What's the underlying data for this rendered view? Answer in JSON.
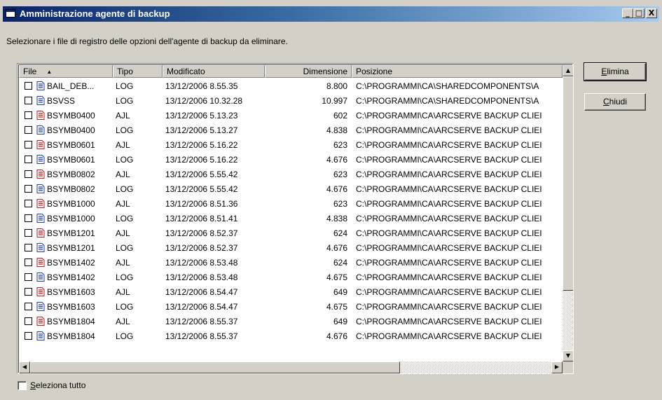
{
  "window": {
    "title": "Amministrazione agente di backup",
    "minimize_glyph": "_",
    "maximize_glyph": "□",
    "close_glyph": "X"
  },
  "instruction": "Selezionare i file di registro delle opzioni dell'agente di backup da eliminare.",
  "columns": {
    "file": "File",
    "tipo": "Tipo",
    "modificato": "Modificato",
    "dimensione": "Dimensione",
    "posizione": "Posizione",
    "sort_indicator": "▲"
  },
  "rows": [
    {
      "file": "BAIL_DEB...",
      "tipo": "LOG",
      "modificato": "13/12/2006 8.55.35",
      "dimensione": "8.800",
      "posizione": "C:\\PROGRAMMI\\CA\\SHAREDCOMPONENTS\\A",
      "icon": "log-file-icon"
    },
    {
      "file": "BSVSS",
      "tipo": "LOG",
      "modificato": "13/12/2006 10.32.28",
      "dimensione": "10.997",
      "posizione": "C:\\PROGRAMMI\\CA\\SHAREDCOMPONENTS\\A",
      "icon": "log-file-icon"
    },
    {
      "file": "BSYMB0400",
      "tipo": "AJL",
      "modificato": "13/12/2006 5.13.23",
      "dimensione": "602",
      "posizione": "C:\\PROGRAMMI\\CA\\ARCSERVE BACKUP CLIEI",
      "icon": "ajl-file-icon"
    },
    {
      "file": "BSYMB0400",
      "tipo": "LOG",
      "modificato": "13/12/2006 5.13.27",
      "dimensione": "4.838",
      "posizione": "C:\\PROGRAMMI\\CA\\ARCSERVE BACKUP CLIEI",
      "icon": "log-file-icon"
    },
    {
      "file": "BSYMB0601",
      "tipo": "AJL",
      "modificato": "13/12/2006 5.16.22",
      "dimensione": "623",
      "posizione": "C:\\PROGRAMMI\\CA\\ARCSERVE BACKUP CLIEI",
      "icon": "ajl-file-icon"
    },
    {
      "file": "BSYMB0601",
      "tipo": "LOG",
      "modificato": "13/12/2006 5.16.22",
      "dimensione": "4.676",
      "posizione": "C:\\PROGRAMMI\\CA\\ARCSERVE BACKUP CLIEI",
      "icon": "log-file-icon"
    },
    {
      "file": "BSYMB0802",
      "tipo": "AJL",
      "modificato": "13/12/2006 5.55.42",
      "dimensione": "623",
      "posizione": "C:\\PROGRAMMI\\CA\\ARCSERVE BACKUP CLIEI",
      "icon": "ajl-file-icon"
    },
    {
      "file": "BSYMB0802",
      "tipo": "LOG",
      "modificato": "13/12/2006 5.55.42",
      "dimensione": "4.676",
      "posizione": "C:\\PROGRAMMI\\CA\\ARCSERVE BACKUP CLIEI",
      "icon": "log-file-icon"
    },
    {
      "file": "BSYMB1000",
      "tipo": "AJL",
      "modificato": "13/12/2006 8.51.36",
      "dimensione": "623",
      "posizione": "C:\\PROGRAMMI\\CA\\ARCSERVE BACKUP CLIEI",
      "icon": "ajl-file-icon"
    },
    {
      "file": "BSYMB1000",
      "tipo": "LOG",
      "modificato": "13/12/2006 8.51.41",
      "dimensione": "4.838",
      "posizione": "C:\\PROGRAMMI\\CA\\ARCSERVE BACKUP CLIEI",
      "icon": "log-file-icon"
    },
    {
      "file": "BSYMB1201",
      "tipo": "AJL",
      "modificato": "13/12/2006 8.52.37",
      "dimensione": "624",
      "posizione": "C:\\PROGRAMMI\\CA\\ARCSERVE BACKUP CLIEI",
      "icon": "ajl-file-icon"
    },
    {
      "file": "BSYMB1201",
      "tipo": "LOG",
      "modificato": "13/12/2006 8.52.37",
      "dimensione": "4.676",
      "posizione": "C:\\PROGRAMMI\\CA\\ARCSERVE BACKUP CLIEI",
      "icon": "log-file-icon"
    },
    {
      "file": "BSYMB1402",
      "tipo": "AJL",
      "modificato": "13/12/2006 8.53.48",
      "dimensione": "624",
      "posizione": "C:\\PROGRAMMI\\CA\\ARCSERVE BACKUP CLIEI",
      "icon": "ajl-file-icon"
    },
    {
      "file": "BSYMB1402",
      "tipo": "LOG",
      "modificato": "13/12/2006 8.53.48",
      "dimensione": "4.675",
      "posizione": "C:\\PROGRAMMI\\CA\\ARCSERVE BACKUP CLIEI",
      "icon": "log-file-icon"
    },
    {
      "file": "BSYMB1603",
      "tipo": "AJL",
      "modificato": "13/12/2006 8.54.47",
      "dimensione": "649",
      "posizione": "C:\\PROGRAMMI\\CA\\ARCSERVE BACKUP CLIEI",
      "icon": "ajl-file-icon"
    },
    {
      "file": "BSYMB1603",
      "tipo": "LOG",
      "modificato": "13/12/2006 8.54.47",
      "dimensione": "4.675",
      "posizione": "C:\\PROGRAMMI\\CA\\ARCSERVE BACKUP CLIEI",
      "icon": "log-file-icon"
    },
    {
      "file": "BSYMB1804",
      "tipo": "AJL",
      "modificato": "13/12/2006 8.55.37",
      "dimensione": "649",
      "posizione": "C:\\PROGRAMMI\\CA\\ARCSERVE BACKUP CLIEI",
      "icon": "ajl-file-icon"
    },
    {
      "file": "BSYMB1804",
      "tipo": "LOG",
      "modificato": "13/12/2006 8.55.37",
      "dimensione": "4.676",
      "posizione": "C:\\PROGRAMMI\\CA\\ARCSERVE BACKUP CLIEI",
      "icon": "log-file-icon"
    }
  ],
  "buttons": {
    "elimina_first": "E",
    "elimina_rest": "limina",
    "chiudi_first": "C",
    "chiudi_rest": "hiudi"
  },
  "select_all": {
    "label_first": "S",
    "label_rest": "eleziona tutto",
    "checked": false
  },
  "scroll": {
    "up": "▲",
    "down": "▼",
    "left": "◀",
    "right": "▶"
  },
  "colors": {
    "title_start": "#0a246a",
    "title_end": "#a6caf0",
    "log_icon": "#1f3fa8",
    "ajl_icon": "#c01818"
  }
}
